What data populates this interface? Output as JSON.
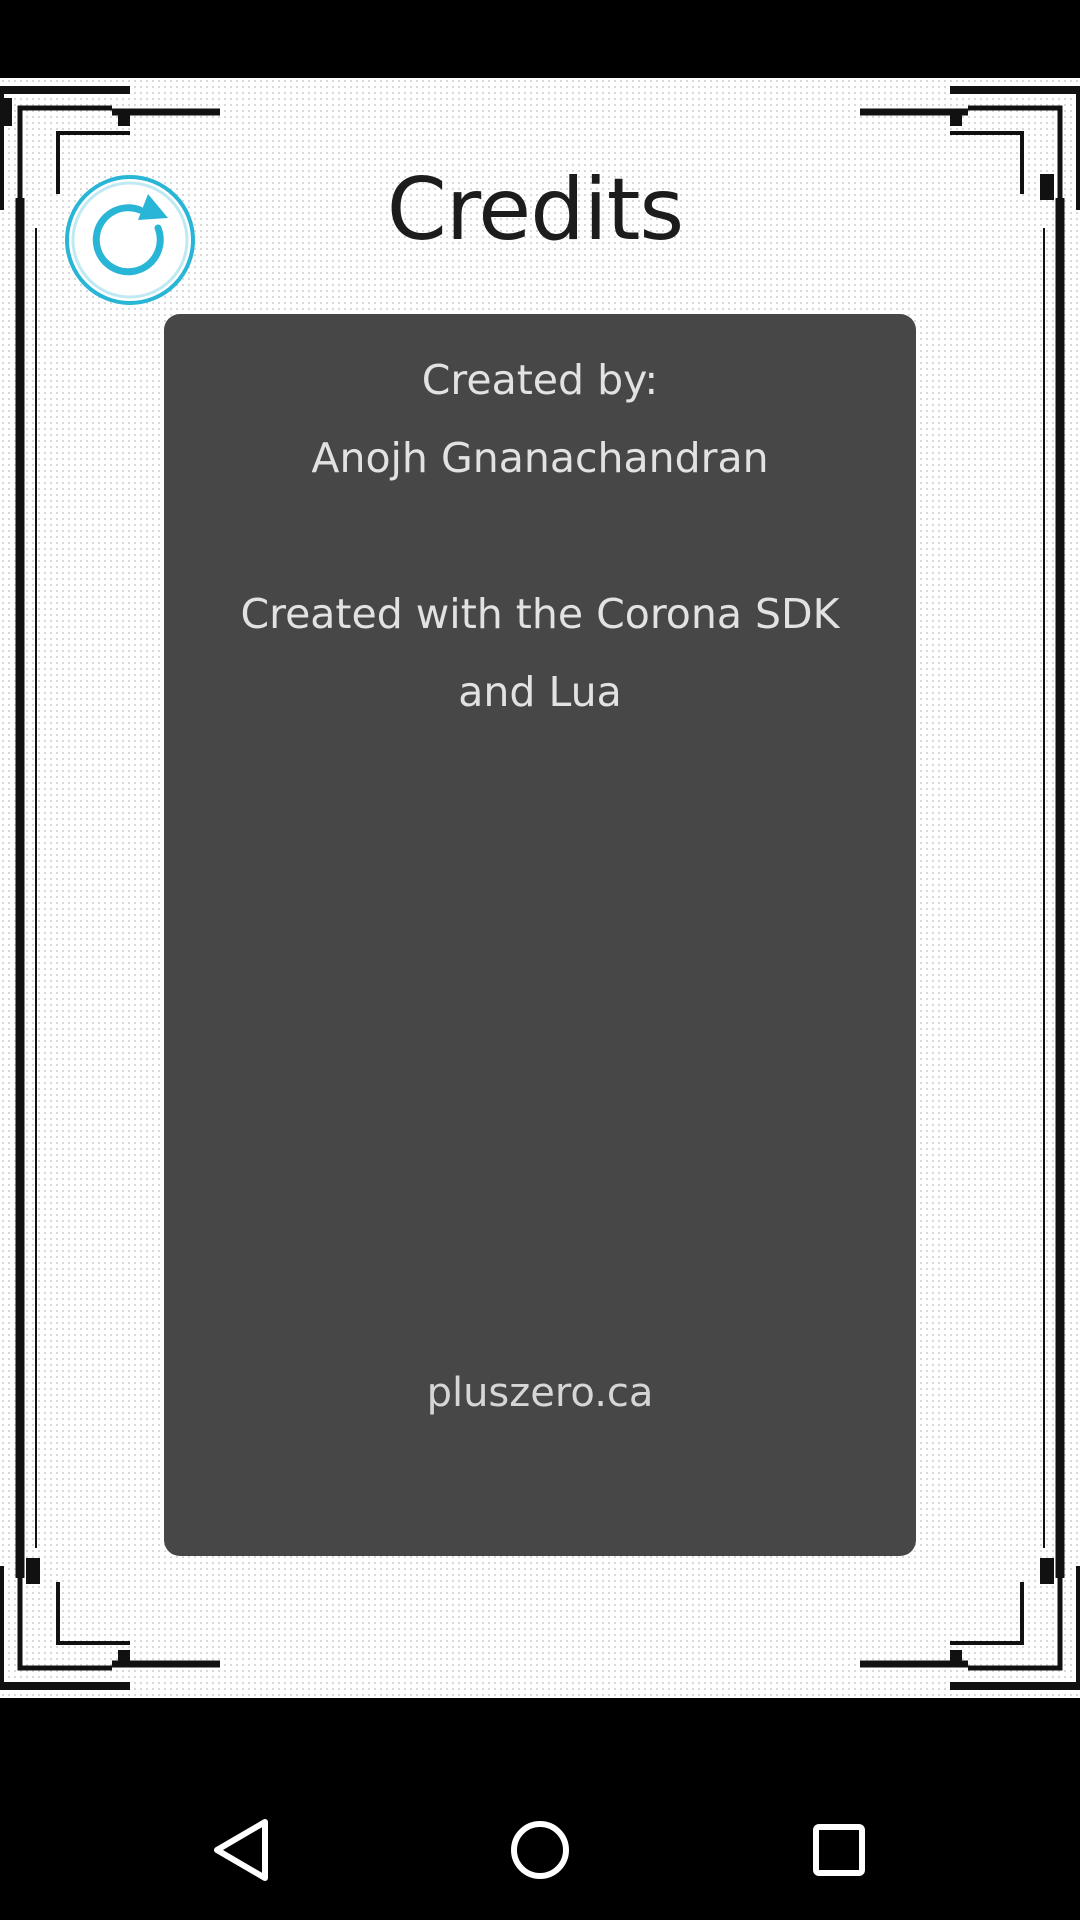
{
  "screen": {
    "title": "Credits"
  },
  "replay_button": {
    "icon": "replay-icon",
    "color": "#29b6d6"
  },
  "credits": {
    "created_by_label": "Created by:",
    "author": "Anojh Gnanachandran",
    "tools_line_1": "Created with the Corona SDK",
    "tools_line_2": "and Lua",
    "website": "pluszero.ca"
  },
  "colors": {
    "panel": "#474747",
    "panel_text": "#e2e2e2",
    "frame": "#111111",
    "accent": "#29b6d6"
  },
  "navigation": {
    "back_icon": "back-triangle-icon",
    "home_icon": "home-circle-icon",
    "recents_icon": "recents-square-icon"
  }
}
